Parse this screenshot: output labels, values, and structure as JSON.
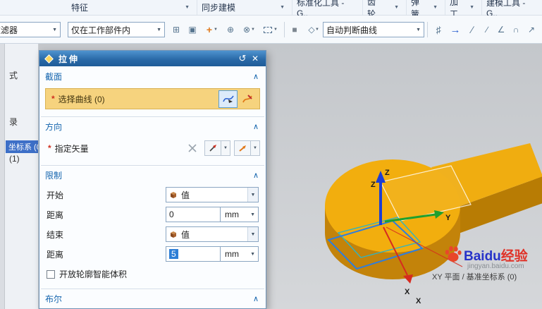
{
  "icons": {
    "dropdown": "▼",
    "collapse": "∧",
    "reset": "↺",
    "close": "✕"
  },
  "menubar": {
    "tabs": [
      {
        "label": "特征"
      },
      {
        "label": "同步建模"
      },
      {
        "label": "标准化工具 - G.."
      },
      {
        "label": "齿轮.."
      },
      {
        "label": "弹簧.."
      },
      {
        "label": "加工.."
      },
      {
        "label": "建模工具 - G.."
      }
    ]
  },
  "toolbar": {
    "filter_value": "过滤器",
    "scope_value": "仅在工作部件内",
    "curve_rule_value": "自动判断曲线",
    "icons_left": [
      {
        "name": "datum-grid-icon",
        "glyph": "⊞"
      },
      {
        "name": "snap-point-icon",
        "glyph": "▣"
      },
      {
        "name": "point-constructor-icon",
        "glyph": "+"
      },
      {
        "name": "snap-intersection-icon",
        "glyph": "⊕"
      },
      {
        "name": "snap-quadrant-icon",
        "glyph": "⊗"
      },
      {
        "name": "marquee-select-icon",
        "glyph": ""
      },
      {
        "name": "solid-body-filter-icon",
        "glyph": "■"
      },
      {
        "name": "facet-filter-icon",
        "glyph": "◇"
      }
    ],
    "icons_right": [
      {
        "name": "fit-window-icon",
        "glyph": "♯"
      },
      {
        "name": "vector-arrow-icon",
        "glyph": "→"
      },
      {
        "name": "line-icon",
        "glyph": "∕"
      },
      {
        "name": "profile-line-icon",
        "glyph": "∕"
      },
      {
        "name": "angle-icon",
        "glyph": "∠"
      },
      {
        "name": "arc-icon",
        "glyph": "∩"
      },
      {
        "name": "point-arrow-icon",
        "glyph": "↗"
      }
    ]
  },
  "navigator": {
    "items": [
      {
        "label": "式"
      },
      {
        "label": "录"
      },
      {
        "label": "坐标系 (0"
      },
      {
        "label": "(1)"
      }
    ]
  },
  "dialog": {
    "title": "拉伸",
    "required_mark": "*",
    "groups": {
      "section": {
        "title": "截面",
        "select_curve_label": "选择曲线 (0)"
      },
      "direction": {
        "title": "方向",
        "specify_vector_label": "指定矢量"
      },
      "limits": {
        "title": "限制",
        "start_label": "开始",
        "start_value": "值",
        "distance1_label": "距离",
        "distance1_value": "0",
        "distance1_unit": "mm",
        "end_label": "结束",
        "end_value": "值",
        "distance2_label": "距离",
        "distance2_value": "5",
        "distance2_unit": "mm",
        "checkbox_label": "开放轮廓智能体积"
      },
      "boolean": {
        "title": "布尔"
      }
    }
  },
  "viewport": {
    "axis_x": "X",
    "axis_y": "Y",
    "axis_z": "Z",
    "status_text": "XY 平面 / 基准坐标系 (0)",
    "watermark": {
      "brand": "Baidu",
      "brand_suffix": "经验",
      "url": "jingyan.baidu.com"
    }
  },
  "colors": {
    "solid_top": "#f2ae0e",
    "solid_side": "#c3830a",
    "accent_blue": "#2d7de0",
    "selection_orange": "#f6d37e"
  }
}
